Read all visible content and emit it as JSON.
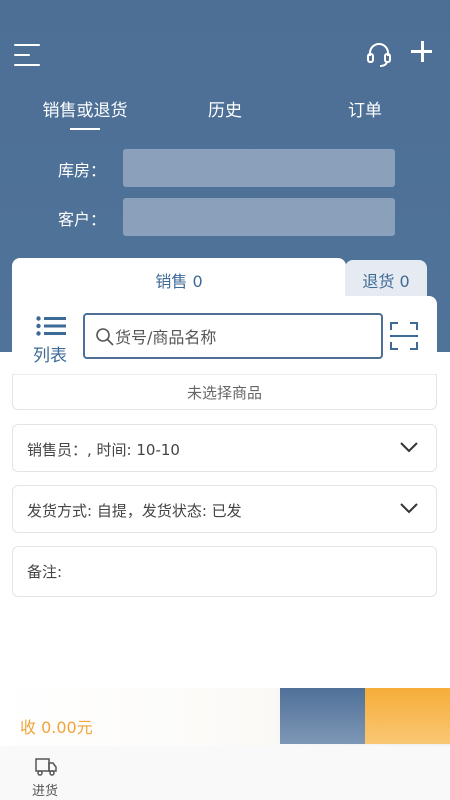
{
  "header": {
    "tabs": [
      {
        "label": "销售或退货",
        "active": true
      },
      {
        "label": "历史",
        "active": false
      },
      {
        "label": "订单",
        "active": false
      }
    ],
    "form": {
      "warehouse_label": "库房：",
      "warehouse_value": "",
      "customer_label": "客户：",
      "customer_value": ""
    }
  },
  "cart": {
    "tabs": [
      {
        "label": "销售 0",
        "active": true
      },
      {
        "label": "退货 0",
        "active": false
      }
    ],
    "list_label": "列表",
    "search_placeholder": "货号/商品名称",
    "empty_text": "未选择商品"
  },
  "info": {
    "salesperson": "销售员：, 时间: 10-10",
    "shipping": "发货方式: 自提，发货状态: 已发",
    "note": "备注:"
  },
  "footer": {
    "total": "收 0.00元",
    "nav": [
      {
        "label": "进货",
        "icon": "truck-icon"
      }
    ]
  },
  "colors": {
    "header_blue": "#4d6f95",
    "accent_orange": "#f6ad39",
    "text_blue": "#3d6a97"
  }
}
